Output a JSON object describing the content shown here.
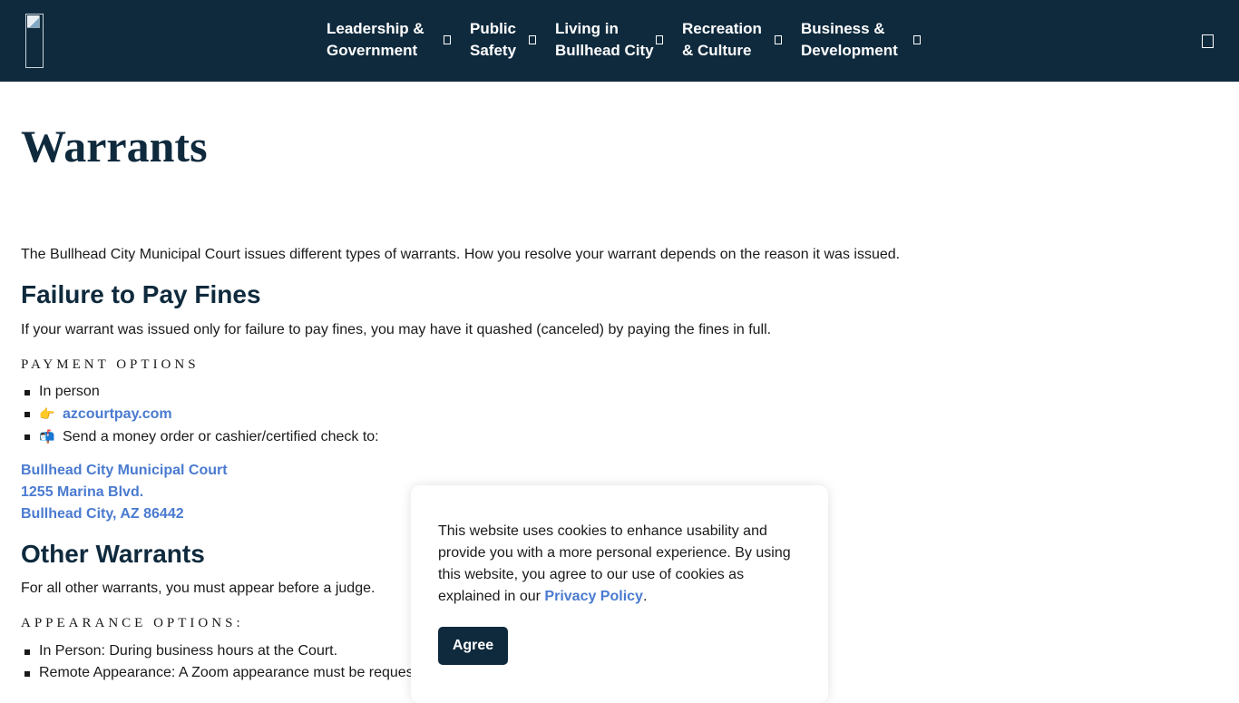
{
  "header": {
    "logo_alt": "",
    "nav": [
      {
        "line1": "Leadership &",
        "line2": "Government"
      },
      {
        "line1": "Public",
        "line2": "Safety"
      },
      {
        "line1": "Living in",
        "line2": "Bullhead City"
      },
      {
        "line1": "Recreation",
        "line2": "& Culture"
      },
      {
        "line1": "Business &",
        "line2": "Development"
      }
    ],
    "nav_icon": "chevron-down-icon",
    "search_icon": "search-icon"
  },
  "main": {
    "title": "Warrants",
    "intro": "The Bullhead City Municipal Court issues different types of warrants. How you resolve your warrant depends on the reason it was issued.",
    "section1": {
      "heading": "Failure to Pay Fines",
      "text": "If your warrant was issued only for failure to pay fines, you may have it quashed (canceled) by paying the fines in full.",
      "options_label": "PAYMENT OPTIONS",
      "options": [
        {
          "emoji": "",
          "text": "In person"
        },
        {
          "emoji": "👉",
          "text": "azcourtpay.com"
        },
        {
          "emoji": "📬",
          "text": "Send a money order or cashier/certified check to:"
        }
      ],
      "address": [
        "Bullhead City Municipal Court",
        "1255 Marina Blvd.",
        "Bullhead City, AZ 86442"
      ]
    },
    "section2": {
      "heading": "Other Warrants",
      "text": "For all other warrants, you must appear before a judge.",
      "options_label": "APPEARANCE OPTIONS:",
      "options": [
        "In Person: During business hours at the Court.",
        "Remote Appearance: A Zoom appearance must be reques"
      ]
    }
  },
  "cookie": {
    "text_before": "This website uses cookies to enhance usability and provide you with a more personal experience. By using this website, you agree to our use of cookies as explained in our ",
    "link": "Privacy Policy",
    "text_after": ".",
    "agree_label": "Agree"
  },
  "colors": {
    "header_bg": "#0f2a3d",
    "link": "#4a7bd0",
    "button_bg": "#0f2a3d"
  }
}
